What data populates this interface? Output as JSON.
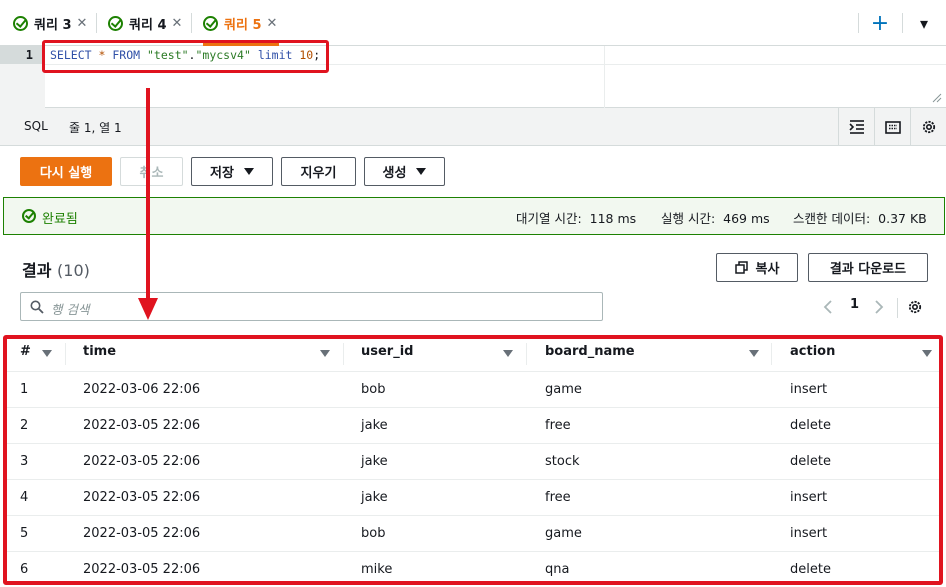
{
  "tabs": [
    {
      "label": "쿼리 3",
      "active": false
    },
    {
      "label": "쿼리 4",
      "active": false
    },
    {
      "label": "쿼리 5",
      "active": true
    }
  ],
  "tab_controls": {
    "add": "+",
    "menu": "▾"
  },
  "editor": {
    "line_number": "1",
    "code": {
      "select": "SELECT",
      "star": "*",
      "from": "FROM",
      "db": "\"test\"",
      "dot": ".",
      "table": "\"mycsv4\"",
      "limit": "limit",
      "num": "10",
      "semi": ";"
    }
  },
  "statusbar": {
    "language": "SQL",
    "position": "줄 1, 열 1"
  },
  "actions": {
    "run_again": "다시 실행",
    "cancel": "취소",
    "save": "저장",
    "clear": "지우기",
    "create": "생성"
  },
  "completed": {
    "label": "완료됨",
    "queue_label": "대기열 시간:",
    "queue_value": "118 ms",
    "run_label": "실행 시간:",
    "run_value": "469 ms",
    "scan_label": "스캔한 데이터:",
    "scan_value": "0.37 KB"
  },
  "results": {
    "title": "결과",
    "count": "(10)",
    "copy_button": "복사",
    "download_button": "결과 다운로드",
    "search_placeholder": "행 검색",
    "page": "1",
    "columns": [
      "#",
      "time",
      "user_id",
      "board_name",
      "action"
    ],
    "rows": [
      {
        "n": "1",
        "time": "2022-03-06 22:06",
        "user_id": "bob",
        "board_name": "game",
        "action": "insert"
      },
      {
        "n": "2",
        "time": "2022-03-05 22:06",
        "user_id": "jake",
        "board_name": "free",
        "action": "delete"
      },
      {
        "n": "3",
        "time": "2022-03-05 22:06",
        "user_id": "jake",
        "board_name": "stock",
        "action": "delete"
      },
      {
        "n": "4",
        "time": "2022-03-05 22:06",
        "user_id": "jake",
        "board_name": "free",
        "action": "insert"
      },
      {
        "n": "5",
        "time": "2022-03-05 22:06",
        "user_id": "bob",
        "board_name": "game",
        "action": "insert"
      },
      {
        "n": "6",
        "time": "2022-03-05 22:06",
        "user_id": "mike",
        "board_name": "qna",
        "action": "delete"
      }
    ]
  },
  "colors": {
    "accent": "#ec7211",
    "success": "#1d8102",
    "annotation": "#e0131f",
    "link": "#0073bb"
  }
}
